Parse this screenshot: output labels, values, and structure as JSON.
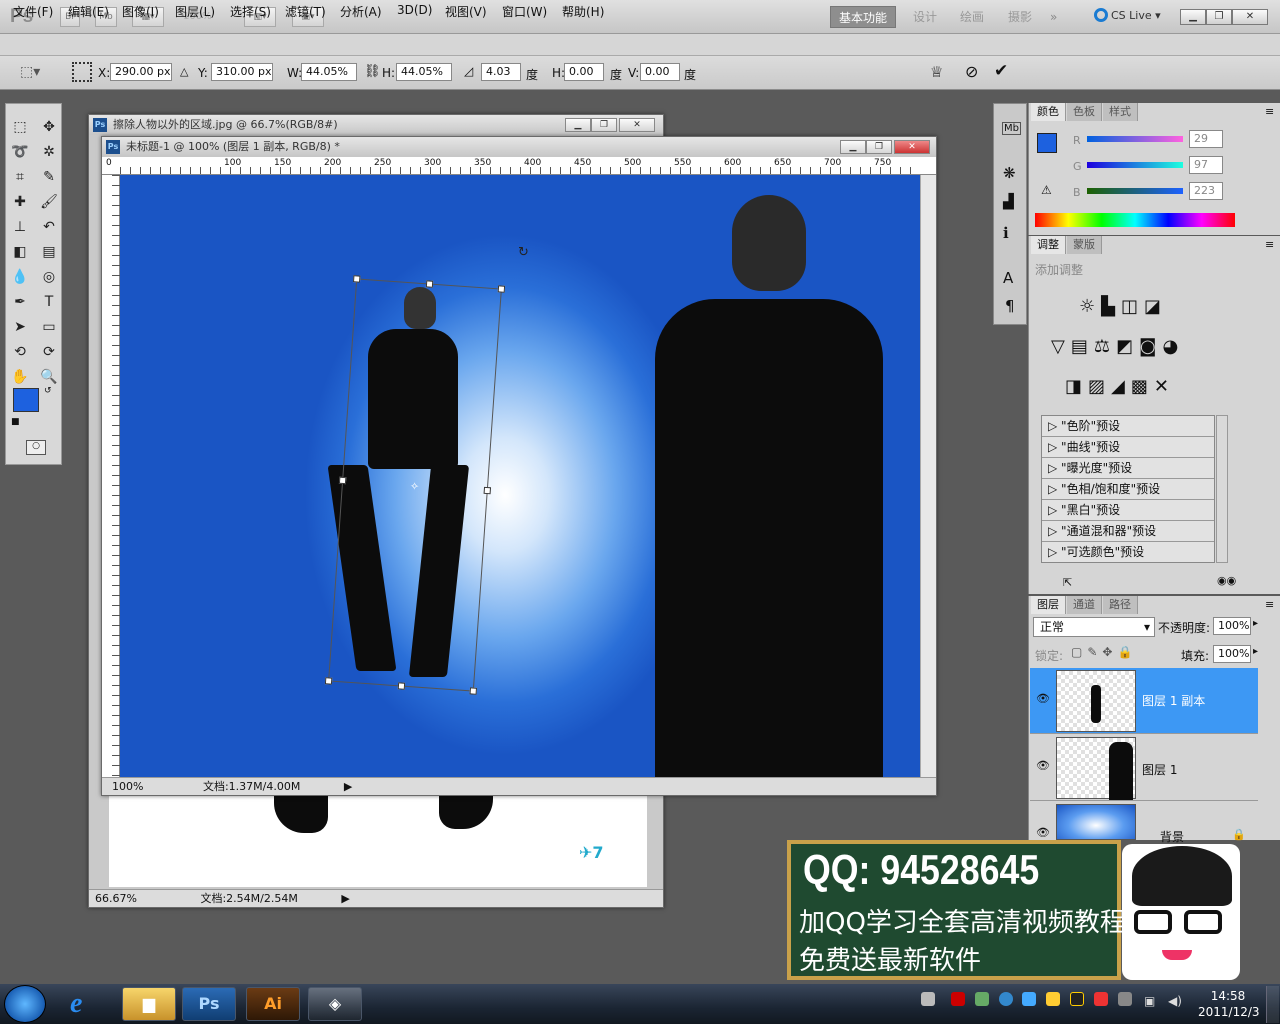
{
  "app": {
    "logo": "Ps",
    "zoom_level": "100%"
  },
  "workspaces": [
    "基本功能",
    "设计",
    "绘画",
    "摄影"
  ],
  "workspace_more": "»",
  "cslive": "CS Live",
  "menu": [
    "文件(F)",
    "编辑(E)",
    "图像(I)",
    "图层(L)",
    "选择(S)",
    "滤镜(T)",
    "分析(A)",
    "3D(D)",
    "视图(V)",
    "窗口(W)",
    "帮助(H)"
  ],
  "options": {
    "x_label": "X:",
    "x": "290.00 px",
    "y_label": "Y:",
    "y": "310.00 px",
    "w_label": "W:",
    "w": "44.05%",
    "h_label": "H:",
    "h": "44.05%",
    "angle": "4.03",
    "angle_unit": "度",
    "hskew_label": "H:",
    "hskew": "0.00",
    "hskew_unit": "度",
    "vskew_label": "V:",
    "vskew": "0.00",
    "vskew_unit": "度"
  },
  "doc_back": {
    "title": "擦除人物以外的区域.jpg @ 66.7%(RGB/8#)",
    "zoom": "66.67%",
    "docsize": "文档:2.54M/2.54M"
  },
  "doc_front": {
    "title": "未标题-1 @ 100% (图层 1 副本, RGB/8) *",
    "zoom": "100%",
    "docsize": "文档:1.37M/4.00M",
    "ruler": [
      "100",
      "150",
      "200",
      "250",
      "300",
      "350",
      "400",
      "450",
      "500",
      "550",
      "600",
      "650",
      "700",
      "750"
    ],
    "ruler_zero": "0"
  },
  "color_panel": {
    "tabs": [
      "颜色",
      "色板",
      "样式"
    ],
    "r_label": "R",
    "g_label": "G",
    "b_label": "B",
    "r": "29",
    "g": "97",
    "b": "223",
    "fg": "#1d61df"
  },
  "adjust_panel": {
    "tabs": [
      "调整",
      "蒙版"
    ],
    "add_label": "添加调整",
    "presets": [
      "\"色阶\"预设",
      "\"曲线\"预设",
      "\"曝光度\"预设",
      "\"色相/饱和度\"预设",
      "\"黑白\"预设",
      "\"通道混和器\"预设",
      "\"可选颜色\"预设"
    ]
  },
  "layers_panel": {
    "tabs": [
      "图层",
      "通道",
      "路径"
    ],
    "blend": "正常",
    "opacity_label": "不透明度:",
    "opacity": "100%",
    "lock_label": "锁定:",
    "fill_label": "填充:",
    "fill": "100%",
    "layers": [
      "图层 1 副本",
      "图层 1",
      "背景"
    ]
  },
  "overlay": {
    "qq": "QQ: 94528645",
    "line1": "加QQ学习全套高清视频教程",
    "line2": "免费送最新软件"
  },
  "taskbar": {
    "time": "14:58",
    "date": "2011/12/3",
    "ps": "Ps",
    "ai": "Ai"
  }
}
